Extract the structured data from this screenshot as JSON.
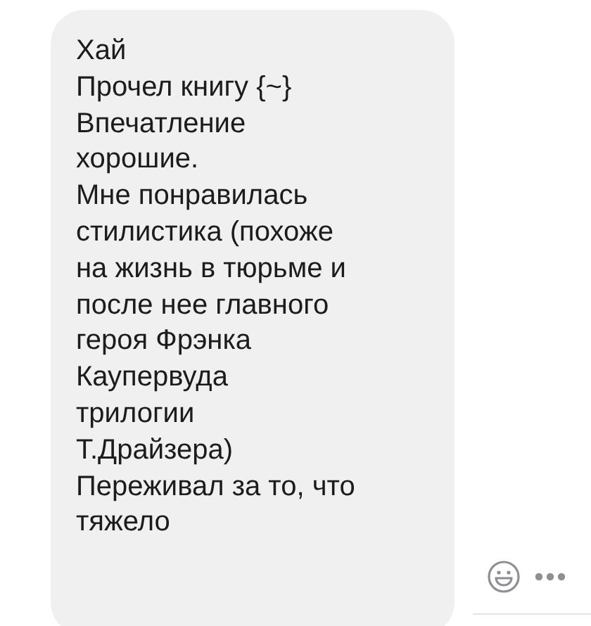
{
  "message": {
    "text": "Хай\nПрочел книгу {~}\nВпечатление\nхорошие.\nМне понравилась\nстилистика (похоже\nна жизнь в тюрьме и\nпосле нее главного\nгероя Фрэнка\nКаупервуда\nтрилогии\nТ.Драйзера)\nПереживал за то, что\nтяжело"
  }
}
